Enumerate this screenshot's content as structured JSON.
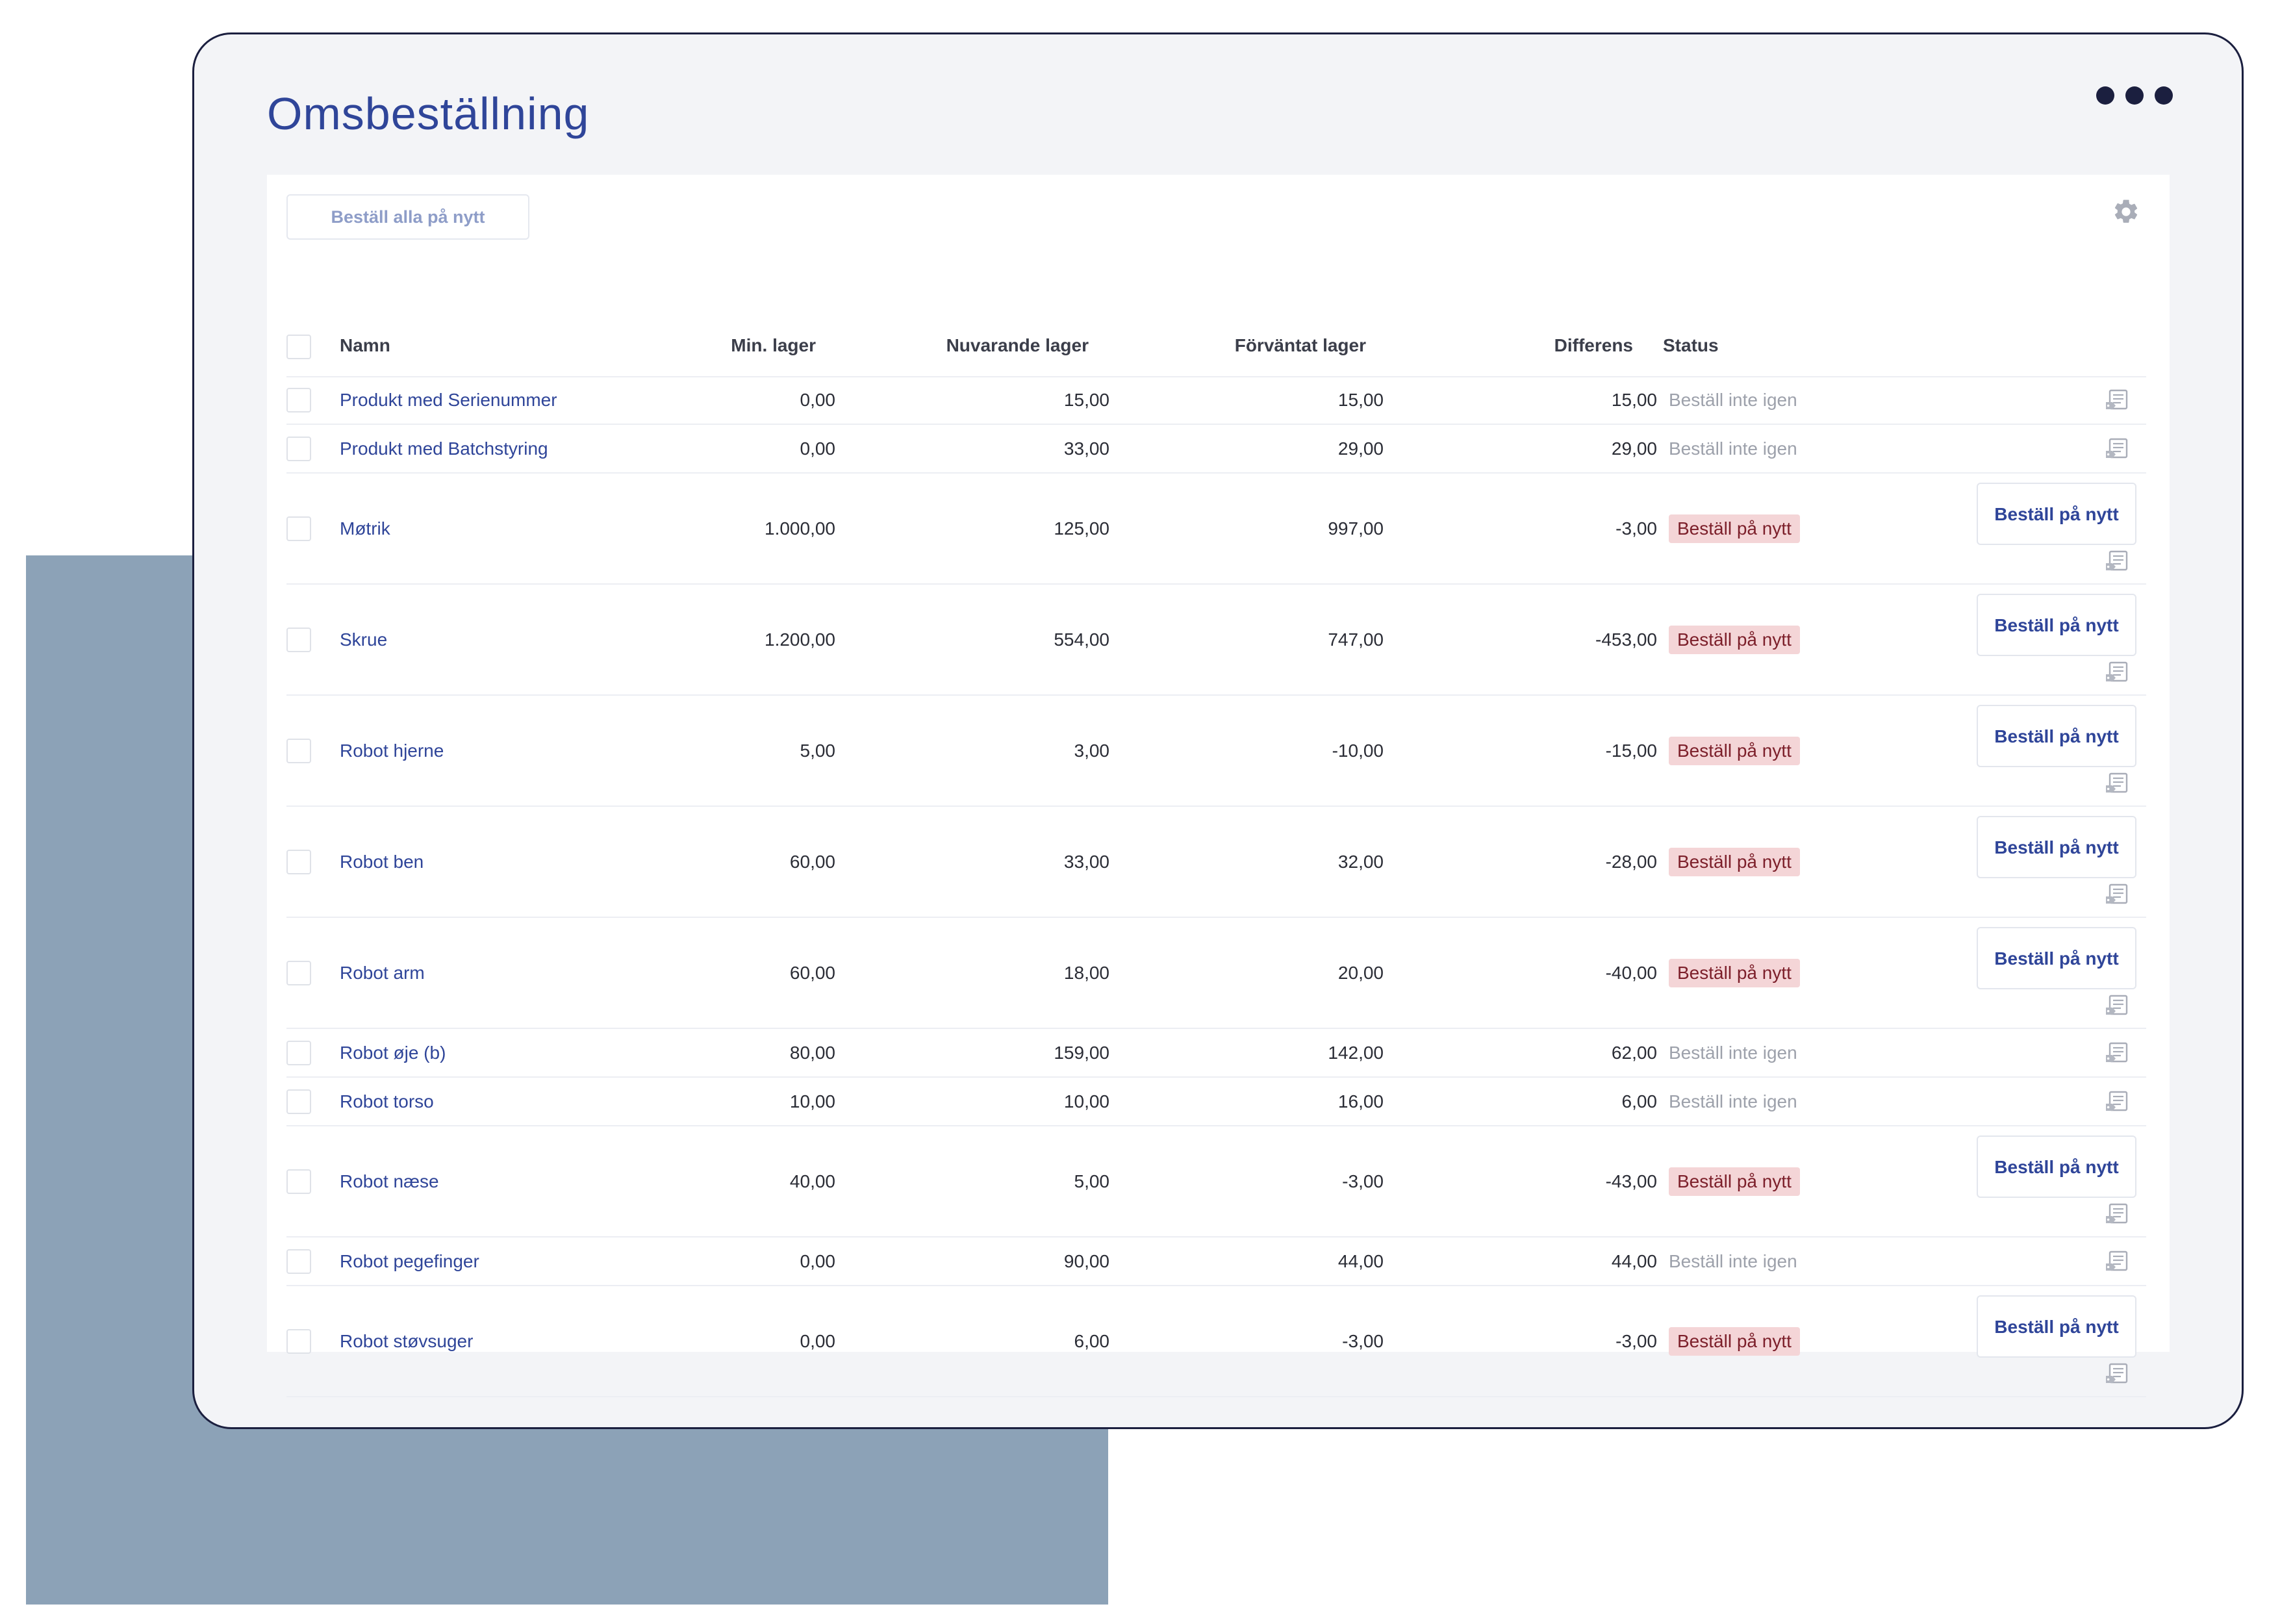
{
  "page": {
    "title": "Omsbeställning",
    "more_icon": "more-horizontal-icon"
  },
  "toolbar": {
    "reorder_all_label": "Beställ alla på nytt",
    "settings_icon": "gear-icon"
  },
  "table": {
    "columns": {
      "name": "Namn",
      "min_stock": "Min. lager",
      "current_stock": "Nuvarande lager",
      "expected_stock": "Förväntat lager",
      "difference": "Differens",
      "status": "Status"
    },
    "reorder_button_label": "Beställ på nytt",
    "note_icon": "note-tag-icon",
    "rows": [
      {
        "name": "Produkt med Serienummer",
        "min": "0,00",
        "current": "15,00",
        "expected": "15,00",
        "diff": "15,00",
        "status": "Beställ inte igen",
        "reorder": false
      },
      {
        "name": "Produkt med Batchstyring",
        "min": "0,00",
        "current": "33,00",
        "expected": "29,00",
        "diff": "29,00",
        "status": "Beställ inte igen",
        "reorder": false
      },
      {
        "name": "Møtrik",
        "min": "1.000,00",
        "current": "125,00",
        "expected": "997,00",
        "diff": "-3,00",
        "status": "Beställ på nytt",
        "reorder": true
      },
      {
        "name": "Skrue",
        "min": "1.200,00",
        "current": "554,00",
        "expected": "747,00",
        "diff": "-453,00",
        "status": "Beställ på nytt",
        "reorder": true
      },
      {
        "name": "Robot hjerne",
        "min": "5,00",
        "current": "3,00",
        "expected": "-10,00",
        "diff": "-15,00",
        "status": "Beställ på nytt",
        "reorder": true
      },
      {
        "name": "Robot ben",
        "min": "60,00",
        "current": "33,00",
        "expected": "32,00",
        "diff": "-28,00",
        "status": "Beställ på nytt",
        "reorder": true
      },
      {
        "name": "Robot arm",
        "min": "60,00",
        "current": "18,00",
        "expected": "20,00",
        "diff": "-40,00",
        "status": "Beställ på nytt",
        "reorder": true
      },
      {
        "name": "Robot øje (b)",
        "min": "80,00",
        "current": "159,00",
        "expected": "142,00",
        "diff": "62,00",
        "status": "Beställ inte igen",
        "reorder": false
      },
      {
        "name": "Robot torso",
        "min": "10,00",
        "current": "10,00",
        "expected": "16,00",
        "diff": "6,00",
        "status": "Beställ inte igen",
        "reorder": false
      },
      {
        "name": "Robot næse",
        "min": "40,00",
        "current": "5,00",
        "expected": "-3,00",
        "diff": "-43,00",
        "status": "Beställ på nytt",
        "reorder": true
      },
      {
        "name": "Robot pegefinger",
        "min": "0,00",
        "current": "90,00",
        "expected": "44,00",
        "diff": "44,00",
        "status": "Beställ inte igen",
        "reorder": false
      },
      {
        "name": "Robot støvsuger",
        "min": "0,00",
        "current": "6,00",
        "expected": "-3,00",
        "diff": "-3,00",
        "status": "Beställ på nytt",
        "reorder": true
      }
    ]
  },
  "colors": {
    "accent": "#2f4599",
    "badge_bg": "#f4d5d7",
    "badge_text": "#7c1f2a",
    "muted_text": "#9da1ab",
    "backdrop": "#8ca2b7",
    "frame": "#1b1f3f"
  }
}
